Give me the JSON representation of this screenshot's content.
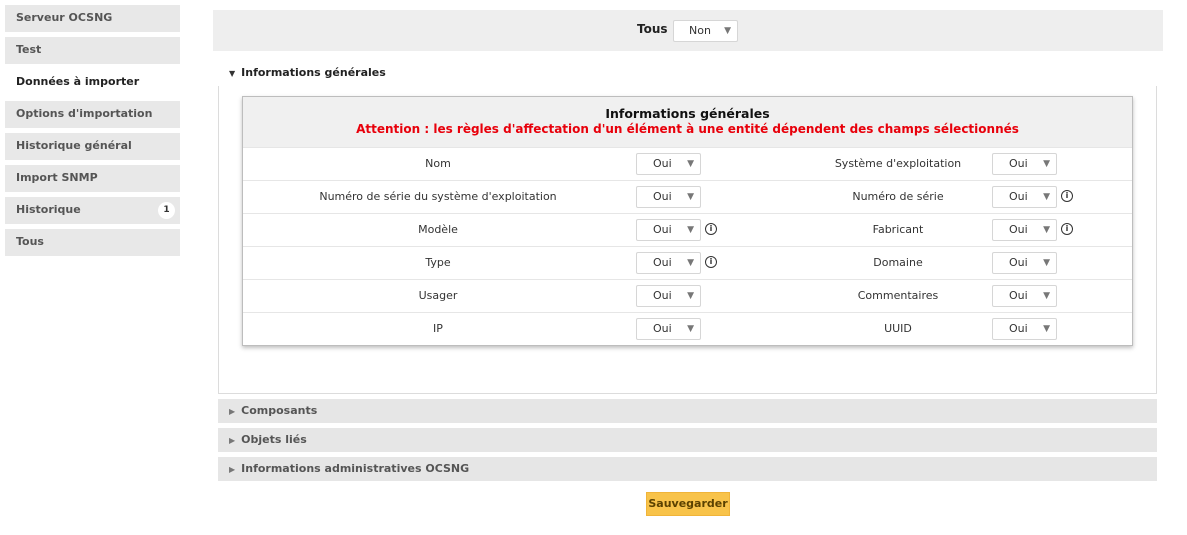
{
  "sidebar": {
    "items": [
      {
        "label": "Serveur OCSNG"
      },
      {
        "label": "Test"
      },
      {
        "label": "Données à importer"
      },
      {
        "label": "Options d'importation"
      },
      {
        "label": "Historique général"
      },
      {
        "label": "Import SNMP"
      },
      {
        "label": "Historique",
        "badge": "1"
      },
      {
        "label": "Tous"
      }
    ]
  },
  "topbar": {
    "tous_label": "Tous",
    "tous_value": "Non"
  },
  "section_general": {
    "header": "Informations générales",
    "card_title": "Informations générales",
    "warning": "Attention : les règles d'affectation d'un élément à une entité dépendent des champs sélectionnés",
    "rows": [
      {
        "left_label": "Nom",
        "left_value": "Oui",
        "right_label": "Système d'exploitation",
        "right_value": "Oui"
      },
      {
        "left_label": "Numéro de série du système d'exploitation",
        "left_value": "Oui",
        "right_label": "Numéro de série",
        "right_value": "Oui"
      },
      {
        "left_label": "Modèle",
        "left_value": "Oui",
        "right_label": "Fabricant",
        "right_value": "Oui"
      },
      {
        "left_label": "Type",
        "left_value": "Oui",
        "right_label": "Domaine",
        "right_value": "Oui"
      },
      {
        "left_label": "Usager",
        "left_value": "Oui",
        "right_label": "Commentaires",
        "right_value": "Oui"
      },
      {
        "left_label": "IP",
        "left_value": "Oui",
        "right_label": "UUID",
        "right_value": "Oui"
      }
    ]
  },
  "collapsed_sections": [
    {
      "label": "Composants"
    },
    {
      "label": "Objets liés"
    },
    {
      "label": "Informations administratives OCSNG"
    }
  ],
  "icons": {
    "info": "info-circle-icon",
    "caret_down": "caret-down-icon",
    "caret_right": "caret-right-icon",
    "select_arrow": "chevron-down-icon"
  },
  "save_label": "Sauvegarder"
}
